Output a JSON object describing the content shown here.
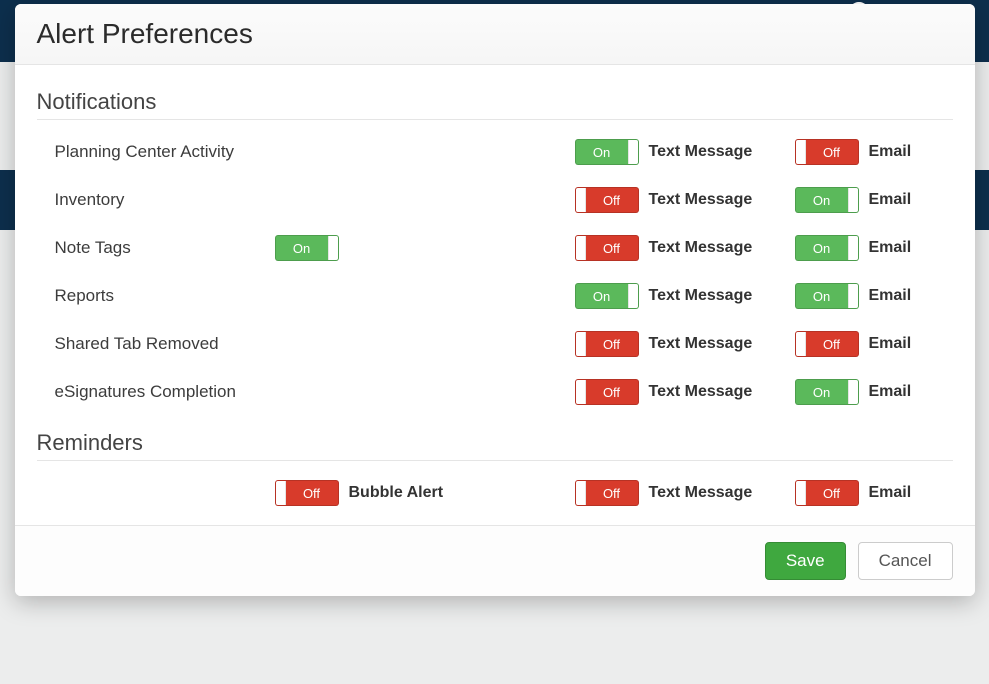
{
  "modal": {
    "title": "Alert Preferences",
    "saveLabel": "Save",
    "cancelLabel": "Cancel"
  },
  "toggleLabels": {
    "on": "On",
    "off": "Off"
  },
  "channels": {
    "text": "Text Message",
    "email": "Email",
    "bubble": "Bubble Alert"
  },
  "sections": {
    "notifications": {
      "title": "Notifications",
      "rows": [
        {
          "id": "planning-center-activity",
          "label": "Planning Center Activity",
          "text": true,
          "email": false
        },
        {
          "id": "inventory",
          "label": "Inventory",
          "text": false,
          "email": true
        },
        {
          "id": "note-tags",
          "label": "Note Tags",
          "master": true,
          "text": false,
          "email": true
        },
        {
          "id": "reports",
          "label": "Reports",
          "text": true,
          "email": true
        },
        {
          "id": "shared-tab-removed",
          "label": "Shared Tab Removed",
          "text": false,
          "email": false
        },
        {
          "id": "esignatures-completion",
          "label": "eSignatures Completion",
          "text": false,
          "email": true
        }
      ]
    },
    "reminders": {
      "title": "Reminders",
      "rows": [
        {
          "id": "reminders-default",
          "label": "",
          "bubble": false,
          "text": false,
          "email": false
        }
      ]
    }
  }
}
